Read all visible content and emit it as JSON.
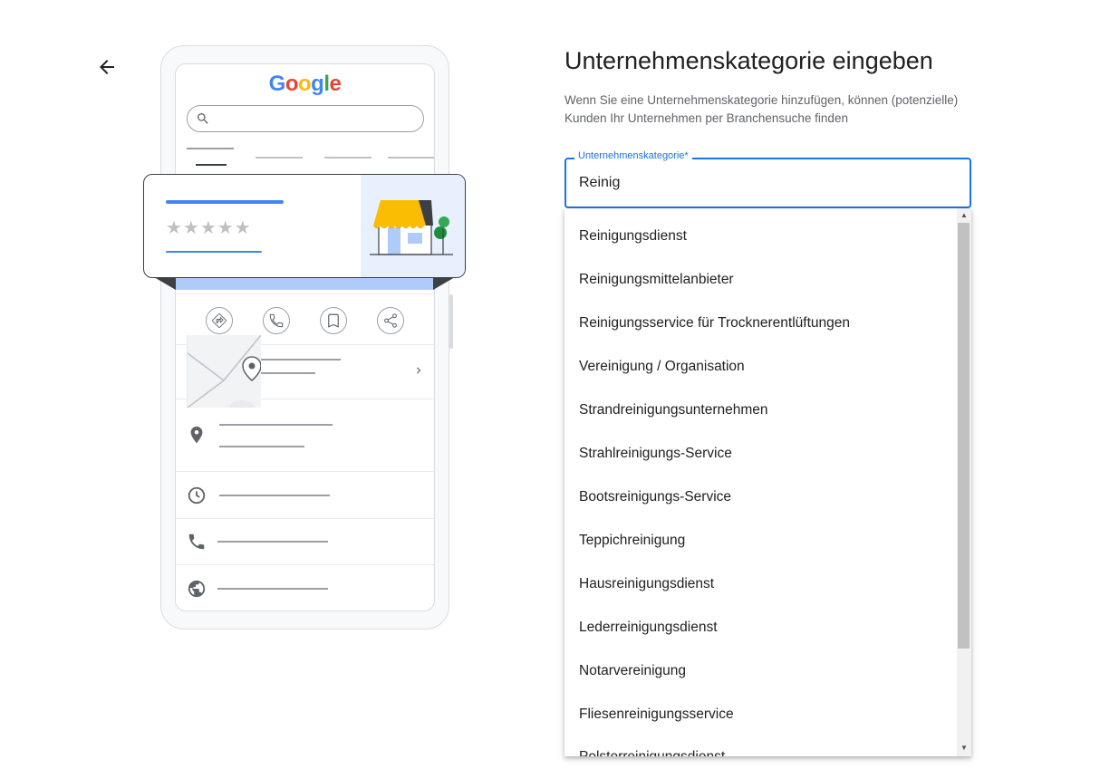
{
  "nav": {
    "back_icon": "arrow-left-icon"
  },
  "illustration": {
    "logo": {
      "G": "G",
      "o1": "o",
      "o2": "o",
      "g": "g",
      "l": "l",
      "e": "e"
    },
    "stars": "★★★★★",
    "colors": {
      "blue": "#4285f4",
      "red": "#ea4335",
      "yellow": "#fbbc05",
      "green": "#34a853",
      "awning": "#fbbc04"
    }
  },
  "page": {
    "title": "Unternehmenskategorie eingeben",
    "subtitle": "Wenn Sie eine Unternehmenskategorie hinzufügen, können (potenzielle) Kunden Ihr Unternehmen per Branchensuche finden"
  },
  "field": {
    "label": "Unternehmenskategorie*",
    "value": "Reinig",
    "accent": "#1a73e8"
  },
  "suggestions": [
    "Reinigungsdienst",
    "Reinigungsmittelanbieter",
    "Reinigungsservice für Trocknerentlüftungen",
    "Vereinigung / Organisation",
    "Strandreinigungsunternehmen",
    "Strahlreinigungs-Service",
    "Bootsreinigungs-Service",
    "Teppichreinigung",
    "Hausreinigungsdienst",
    "Lederreinigungsdienst",
    "Notarvereinigung",
    "Fliesenreinigungsservice",
    "Polsterreinigungsdienst"
  ],
  "scrollbar": {
    "up": "▲",
    "down": "▼"
  }
}
